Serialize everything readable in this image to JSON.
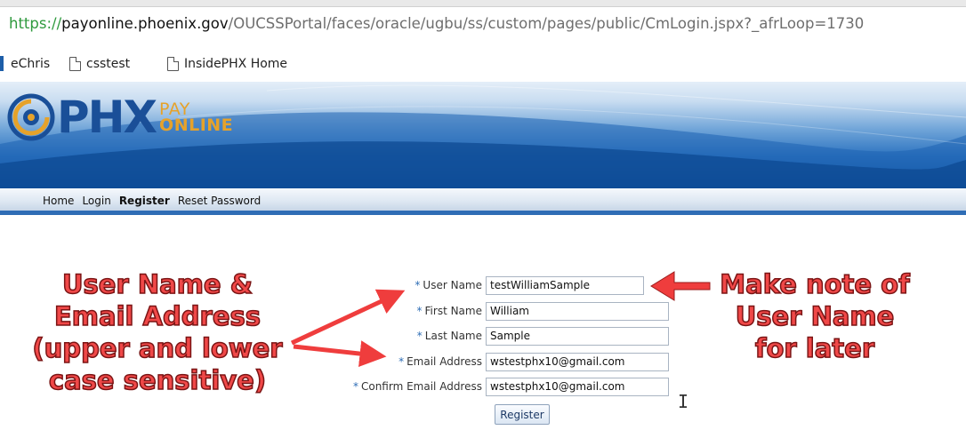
{
  "browser": {
    "url_scheme": "https://",
    "url_host": "payonline.phoenix.gov",
    "url_path": "/OUCSSPortal/faces/oracle/ugbu/ss/custom/pages/public/CmLogin.jspx?_afrLoop=1730",
    "bookmarks": [
      {
        "label": "eChris",
        "icon": "bookmark-folder"
      },
      {
        "label": "csstest",
        "icon": "page-icon"
      },
      {
        "label": "InsidePHX Home",
        "icon": "page-icon"
      }
    ]
  },
  "banner": {
    "logo_text": "PHX",
    "logo_sub_line1": "PAY",
    "logo_sub_line2": "ONLINE"
  },
  "nav": {
    "items": [
      {
        "label": "Home",
        "active": false
      },
      {
        "label": "Login",
        "active": false
      },
      {
        "label": "Register",
        "active": true
      },
      {
        "label": "Reset Password",
        "active": false
      }
    ]
  },
  "form": {
    "required_mark": "*",
    "fields": [
      {
        "label": "User Name",
        "value": "testWilliamSample"
      },
      {
        "label": "First Name",
        "value": "William"
      },
      {
        "label": "Last Name",
        "value": "Sample"
      },
      {
        "label": "Email Address",
        "value": "wstestphx10@gmail.com"
      },
      {
        "label": "Confirm Email Address",
        "value": "wstestphx10@gmail.com"
      }
    ],
    "submit_label": "Register"
  },
  "annotations": {
    "left_lines": [
      "User Name &",
      "Email Address",
      "(upper and lower",
      "case sensitive)"
    ],
    "right_lines": [
      "Make note of",
      "User Name",
      "for later"
    ],
    "color": "#f04848"
  },
  "theme": {
    "brand_blue": "#1a4f98",
    "brand_gold": "#e6a22a",
    "nav_border": "#2f6db5"
  }
}
